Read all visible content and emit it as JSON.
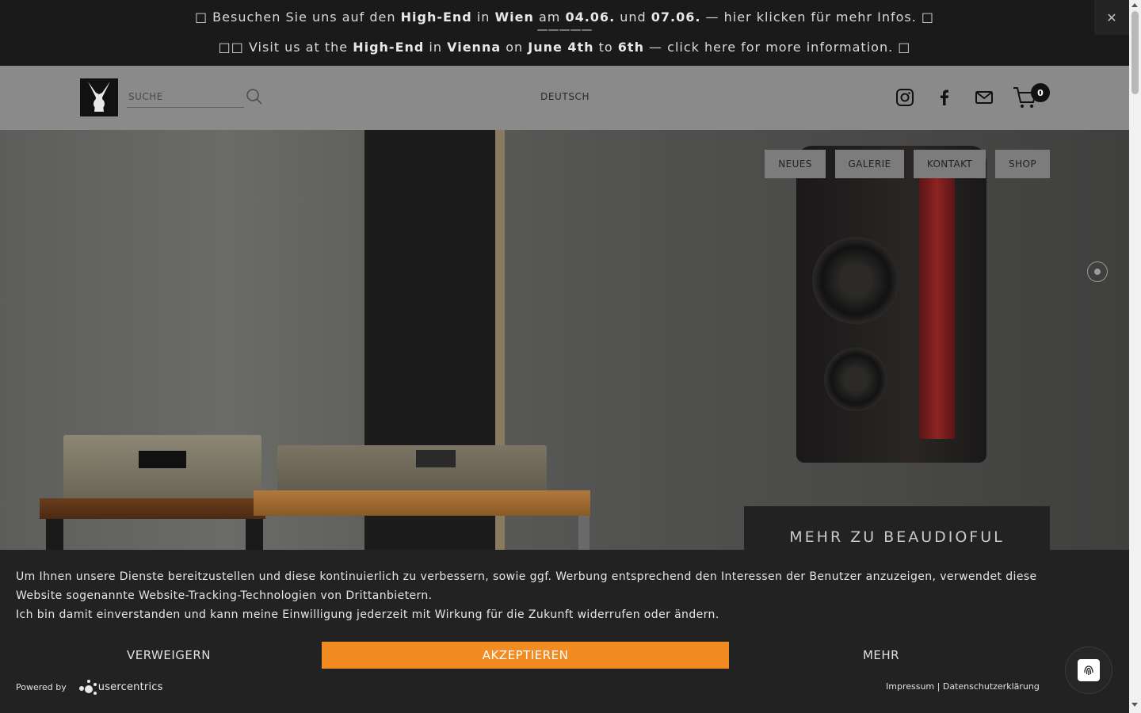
{
  "announcement": {
    "line1": {
      "lead_icon": "□",
      "t1": " Besuchen Sie uns auf den ",
      "b1": "High-End",
      "t2": " in ",
      "b2": "Wien",
      "t3": " am ",
      "b3": "04.06.",
      "t4": " und ",
      "b4": "07.06.",
      "t5": " — hier klicken für mehr Infos. ",
      "trail_icon": "□"
    },
    "divider": "—————",
    "line2": {
      "lead_icon": "□□",
      "t1": " Visit us at the ",
      "b1": "High-End",
      "t2": " in ",
      "b2": "Vienna",
      "t3": " on ",
      "b3": "June 4th",
      "t4": " to ",
      "b4": "6th",
      "t5": " — click here for more information. ",
      "trail_icon": "□"
    },
    "close_label": "✕"
  },
  "header": {
    "search_placeholder": "SUCHE",
    "language": "DEUTSCH",
    "social_icons": [
      "instagram-icon",
      "facebook-icon",
      "mail-icon"
    ],
    "cart_count": "0"
  },
  "nav": {
    "items": [
      "NEUES",
      "GALERIE",
      "KONTAKT",
      "SHOP"
    ]
  },
  "hero": {
    "cta": "MEHR ZU BEAUDIOFUL"
  },
  "cookie": {
    "text_line1": "Um Ihnen unsere Dienste bereitzustellen und diese kontinuierlich zu verbessern, sowie ggf. Werbung entsprechend den Interessen der Benutzer anzuzeigen, verwendet diese Website sogenannte Website-Tracking-Technologien von Drittanbietern.",
    "text_line2": "Ich bin damit einverstanden und kann meine Einwilligung jederzeit mit Wirkung für die Zukunft widerrufen oder ändern.",
    "deny": "VERWEIGERN",
    "accept": "AKZEPTIEREN",
    "more": "MEHR",
    "powered_by": "Powered by",
    "provider": "usercentrics",
    "impressum": "Impressum",
    "separator": " | ",
    "privacy": "Datenschutzerklärung"
  },
  "colors": {
    "accent": "#f28c22",
    "banner_bg": "#222222",
    "header_bg": "#8a8a8a",
    "topbar_bg": "#1a1a1a"
  }
}
